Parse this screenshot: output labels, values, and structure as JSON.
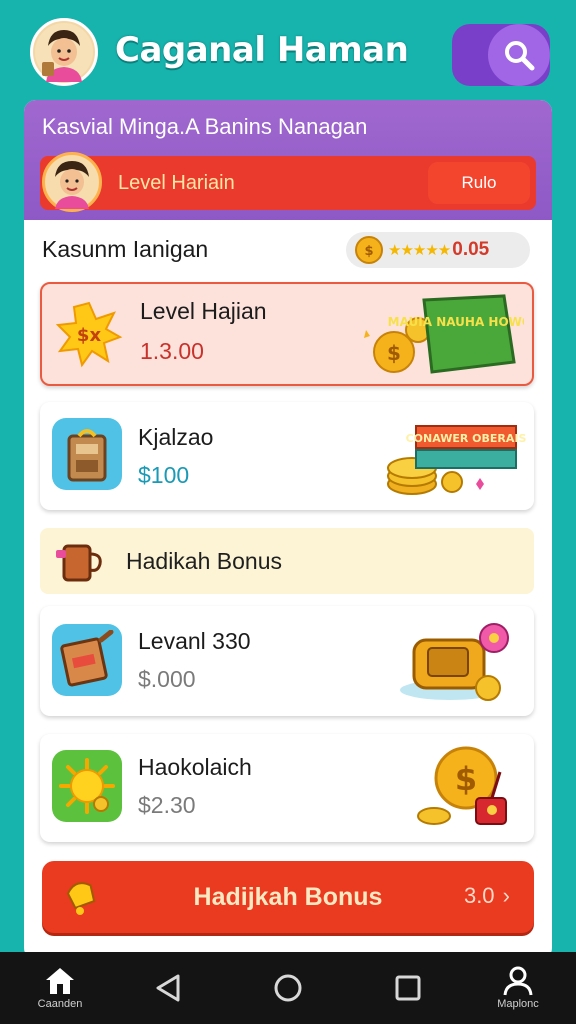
{
  "header": {
    "title": "Caganal Haman",
    "search_icon": "search-icon"
  },
  "card": {
    "top_title": "Kasvial Minga.A Banins Nanagan",
    "level_banner": {
      "label": "Level Hariain",
      "button_label": "Rulo"
    },
    "section_title": "Kasunm Ianigan",
    "rating": {
      "stars": "★★★★★",
      "value": "0.05"
    },
    "items": [
      {
        "title": "Level Hajian",
        "value": "1.3.00",
        "icon": "sun-coin-icon",
        "value_color": "#c8322a",
        "badge": "MAUIA NAUHA HOWOHT"
      },
      {
        "title": "Kjalzao",
        "value": "$100",
        "icon": "gift-box-icon",
        "value_color": "#1a9ab5",
        "badge": "CONAWER OBERAIS"
      },
      {
        "title": "Levanl 330",
        "value": "$.000",
        "icon": "ticket-icon",
        "value_color": "#7a7a7a"
      },
      {
        "title": "Haokolaich",
        "value": "$2.30",
        "icon": "sun-icon",
        "value_color": "#7a7a7a"
      }
    ],
    "bonus_strip_label": "Hadikah Bonus",
    "cta": {
      "label": "Hadijkah Bonus",
      "right_text": "3.0"
    }
  },
  "navbar": {
    "items": [
      {
        "label": "Caanden",
        "icon": "home-icon"
      },
      {
        "label": "",
        "icon": "back-icon"
      },
      {
        "label": "",
        "icon": "circle-home-icon"
      },
      {
        "label": "",
        "icon": "square-recents-icon"
      },
      {
        "label": "Maplonc",
        "icon": "user-icon"
      }
    ]
  },
  "colors": {
    "background": "#17b3ad",
    "purple": "#9a62cc",
    "red": "#ea3a2d",
    "gold": "#f5b700"
  }
}
